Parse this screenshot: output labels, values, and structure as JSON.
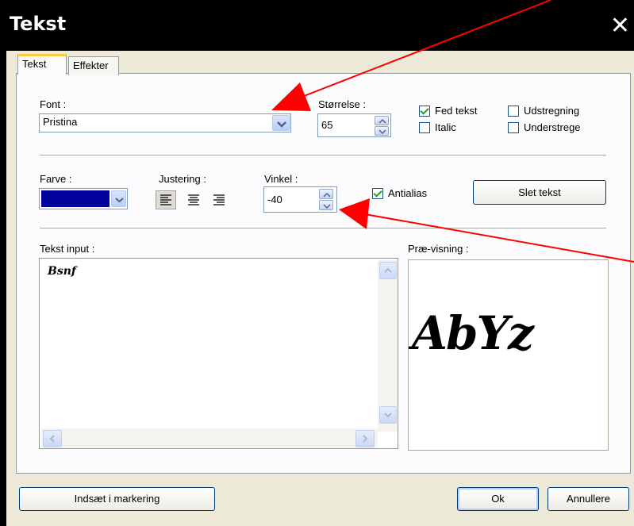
{
  "window": {
    "title": "Tekst",
    "close_glyph": "✕"
  },
  "tabs": [
    {
      "label": "Tekst",
      "active": true
    },
    {
      "label": "Effekter",
      "active": false
    }
  ],
  "font": {
    "label": "Font :",
    "value": "Pristina"
  },
  "size": {
    "label": "Størrelse :",
    "value": "65"
  },
  "style": {
    "bold": {
      "label": "Fed tekst",
      "checked": true
    },
    "italic": {
      "label": "Italic",
      "checked": false
    },
    "strikeout": {
      "label": "Udstregning",
      "checked": false
    },
    "underline": {
      "label": "Understrege",
      "checked": false
    }
  },
  "color": {
    "label": "Farve :",
    "value": "#00009a"
  },
  "alignment": {
    "label": "Justering :",
    "selected": "left"
  },
  "angle": {
    "label": "Vinkel :",
    "value": "-40"
  },
  "antialias": {
    "label": "Antialias",
    "checked": true
  },
  "clear_button": "Slet tekst",
  "text_input": {
    "label": "Tekst input :",
    "value": "Bsnf"
  },
  "preview": {
    "label": "Præ-visning :",
    "sample": "AbYz"
  },
  "footer": {
    "insert_button": "Indsæt i markering",
    "ok_button": "Ok",
    "cancel_button": "Annullere"
  },
  "colors": {
    "accent_arrow": "#ff0000",
    "tab_highlight": "#ffc83c",
    "window_bg": "#ece9d8"
  }
}
